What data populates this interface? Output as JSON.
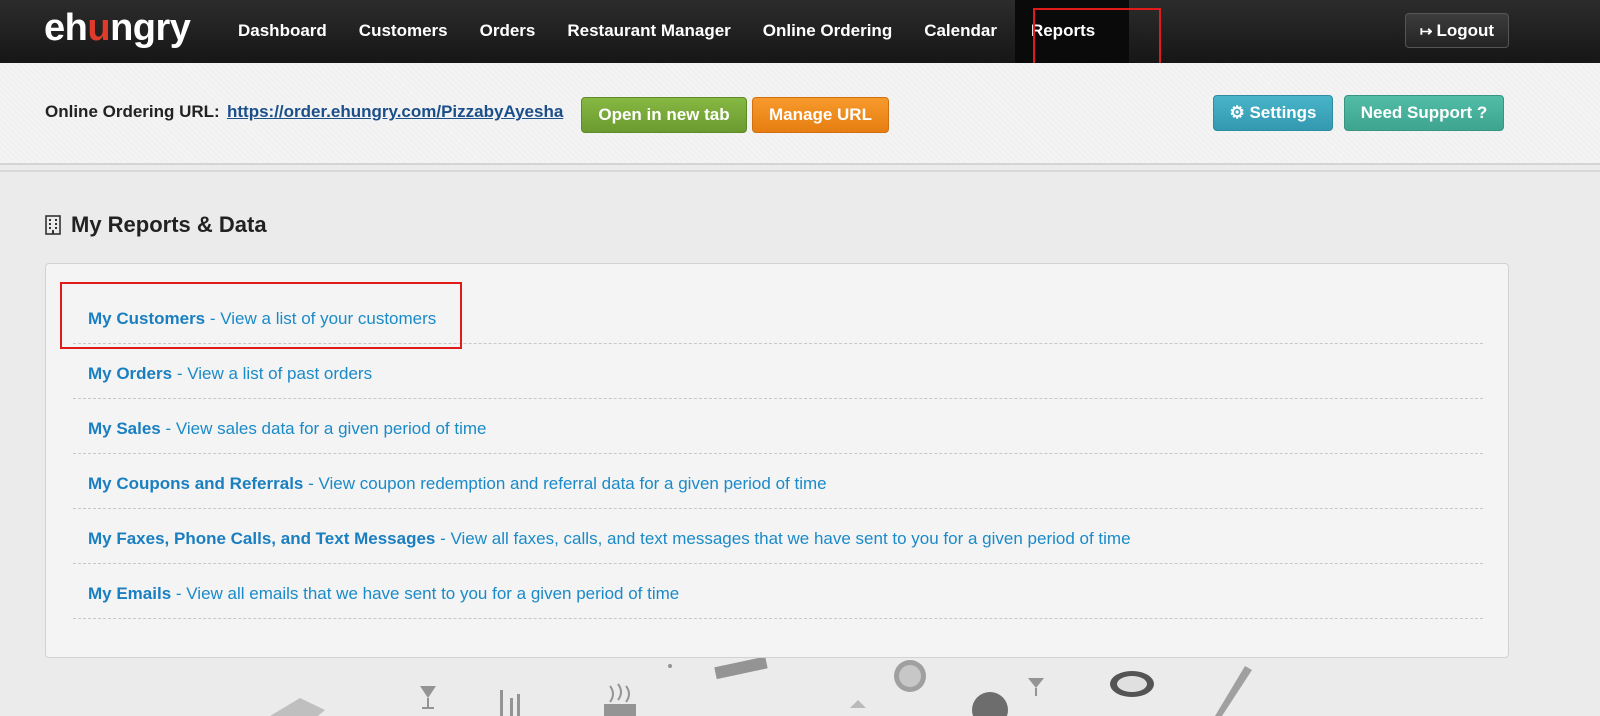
{
  "header": {
    "logo_pre": "eh",
    "logo_u": "u",
    "logo_post": "ngry",
    "nav": [
      {
        "label": "Dashboard"
      },
      {
        "label": "Customers"
      },
      {
        "label": "Orders"
      },
      {
        "label": "Restaurant Manager"
      },
      {
        "label": "Online Ordering"
      },
      {
        "label": "Calendar"
      },
      {
        "label": "Reports",
        "active": true
      }
    ],
    "logout_label": "Logout"
  },
  "url_bar": {
    "label": "Online Ordering URL:",
    "url": "https://order.ehungry.com/PizzabyAyesha",
    "open_label": "Open in new tab",
    "manage_label": "Manage URL",
    "settings_label": "Settings",
    "support_label": "Need Support ?"
  },
  "section": {
    "title": "My Reports & Data"
  },
  "reports": [
    {
      "title": "My Customers",
      "desc": " - View a list of your customers"
    },
    {
      "title": "My Orders",
      "desc": " - View a list of past orders"
    },
    {
      "title": "My Sales",
      "desc": " - View sales data for a given period of time"
    },
    {
      "title": "My Coupons and Referrals",
      "desc": " - View coupon redemption and referral data for a given period of time"
    },
    {
      "title": "My Faxes, Phone Calls, and Text Messages",
      "desc": " - View all faxes, calls, and text messages that we have sent to you for a given period of time"
    },
    {
      "title": "My Emails",
      "desc": " - View all emails that we have sent to you for a given period of time"
    }
  ],
  "colors": {
    "highlight": "#e11a1a",
    "link": "#1a8ac8",
    "green_button": "#7aab3a",
    "orange_button": "#ef8c1f",
    "settings_button": "#3fa8bf",
    "support_button": "#48b19c"
  }
}
